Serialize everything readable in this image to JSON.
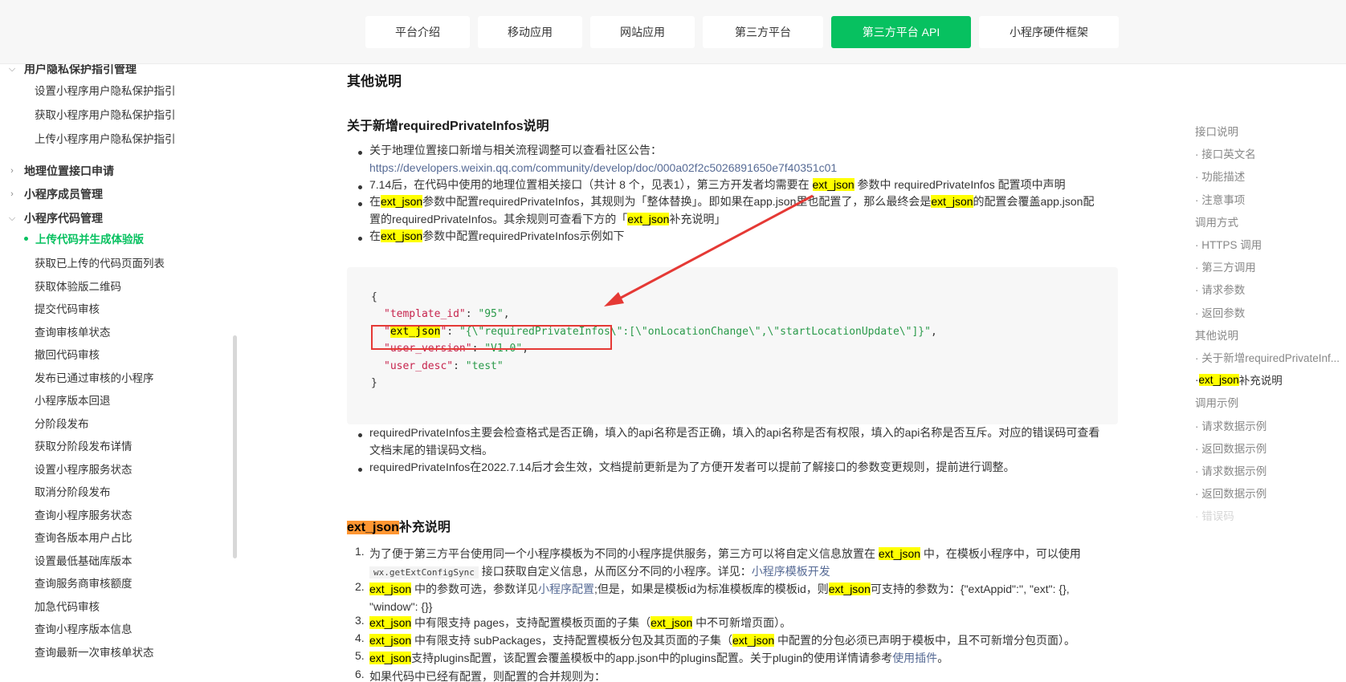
{
  "topnav": [
    {
      "label": "平台介绍",
      "active": false
    },
    {
      "label": "移动应用",
      "active": false
    },
    {
      "label": "网站应用",
      "active": false
    },
    {
      "label": "第三方平台",
      "active": false
    },
    {
      "label": "第三方平台 API",
      "active": true
    },
    {
      "label": "小程序硬件框架",
      "active": false
    }
  ],
  "sidebar": {
    "group_privacy": "用户隐私保护指引管理",
    "privacy_items": [
      "设置小程序用户隐私保护指引",
      "获取小程序用户隐私保护指引",
      "上传小程序用户隐私保护指引"
    ],
    "group_location": "地理位置接口申请",
    "group_members": "小程序成员管理",
    "group_code": "小程序代码管理",
    "active_item": "上传代码并生成体验版",
    "code_items": [
      "获取已上传的代码页面列表",
      "获取体验版二维码",
      "提交代码审核",
      "查询审核单状态",
      "撤回代码审核",
      "发布已通过审核的小程序",
      "小程序版本回退",
      "分阶段发布",
      "获取分阶段发布详情",
      "设置小程序服务状态",
      "取消分阶段发布",
      "查询小程序服务状态",
      "查询各版本用户占比",
      "设置最低基础库版本",
      "查询服务商审核额度",
      "加急代码审核",
      "查询小程序版本信息",
      "查询最新一次审核单状态"
    ]
  },
  "main": {
    "title": "其他说明",
    "section1_title": "关于新增requiredPrivateInfos说明",
    "b1_text": "关于地理位置接口新增与相关流程调整可以查看社区公告：",
    "b1_link": "https://developers.weixin.qq.com/community/develop/doc/000a02f2c5026891650e7f40351c01",
    "b2_a": "7.14后，在代码中使用的地理位置相关接口（共计 8 个，见表1），第三方开发者均需要在 ",
    "ext_json": "ext_json",
    "b2_b": " 参数中 requiredPrivateInfos 配置项中声明",
    "b3_a": "在",
    "b3_b": "参数中配置requiredPrivateInfos，其规则为「整体替换」。即如果在app.json里也配置了，那么最终会是",
    "b3_c": "的配置会覆盖app.json配",
    "b3_d": "置的requiredPrivateInfos。其余规则可查看下方的「",
    "b3_e": "补充说明」",
    "b4_a": "在",
    "b4_b": "参数中配置requiredPrivateInfos示例如下",
    "code": {
      "open": "{",
      "k1": "\"template_id\"",
      "v1": "\"95\"",
      "k2_pre": "\"",
      "k2_hl": "ext_json",
      "k2_post": "\"",
      "v2": "\"{\\\"requiredPrivateInfos\\\":[\\\"onLocationChange\\\",\\\"startLocationUpdate\\\"]}\"",
      "k3": "\"user_version\"",
      "v3": "\"V1.0\"",
      "k4": "\"user_desc\"",
      "v4": "\"test\"",
      "close": "}"
    },
    "b5_a": "requiredPrivateInfos主要会检查格式是否正确，填入的api名称是否正确，填入的api名称是否有权限，填入的api名称是否互斥。对应的错误码可查看",
    "b5_b": "文档末尾的错误码文档。",
    "b6": "requiredPrivateInfos在2022.7.14后才会生效，文档提前更新是为了方便开发者可以提前了解接口的参数变更规则，提前进行调整。",
    "section2_hl": "ext_json",
    "section2_rest": "补充说明",
    "n1_a": "为了便于第三方平台使用同一个小程序模板为不同的小程序提供服务，第三方可以将自定义信息放置在 ",
    "n1_b": " 中，在模板小程序中，可以使用",
    "n1_code": "wx.getExtConfigSync",
    "n1_c": " 接口获取自定义信息，从而区分不同的小程序。详见：",
    "n1_link": "小程序模板开发",
    "n2_a": " 中的参数可选，参数详见",
    "n2_link": "小程序配置",
    "n2_b": ";但是，如果是模板id为标准模板库的模板id，则",
    "n2_c": "可支持的参数为：{\"extAppid\":'', \"ext\": {},",
    "n2_d": "\"window\": {}}",
    "n3_a": " 中有限支持 pages，支持配置模板页面的子集（",
    "n3_b": " 中不可新增页面）。",
    "n4_a": " 中有限支持 subPackages，支持配置模板分包及其页面的子集（",
    "n4_b": " 中配置的分包必须已声明于模板中，且不可新增分包页面）。",
    "n5_a": "支持plugins配置，该配置会覆盖模板中的app.json中的plugins配置。关于plugin的使用详情请参考",
    "n5_link": "使用插件",
    "n5_b": "。",
    "n6": "如果代码中已经有配置，则配置的合并规则为："
  },
  "toc": [
    {
      "label": "接口说明",
      "sub": false
    },
    {
      "label": "· 接口英文名",
      "sub": true
    },
    {
      "label": "· 功能描述",
      "sub": true
    },
    {
      "label": "· 注意事项",
      "sub": true
    },
    {
      "label": "调用方式",
      "sub": false
    },
    {
      "label": "· HTTPS 调用",
      "sub": true
    },
    {
      "label": "· 第三方调用",
      "sub": true
    },
    {
      "label": "· 请求参数",
      "sub": true
    },
    {
      "label": "· 返回参数",
      "sub": true
    },
    {
      "label": "其他说明",
      "sub": false
    },
    {
      "label": "· 关于新增requiredPrivateInf...",
      "sub": true
    },
    {
      "label": "ext_json",
      "rest": "补充说明",
      "sub": true,
      "current": true
    },
    {
      "label": "调用示例",
      "sub": false
    },
    {
      "label": "· 请求数据示例",
      "sub": true
    },
    {
      "label": "· 返回数据示例",
      "sub": true
    },
    {
      "label": "· 请求数据示例",
      "sub": true
    },
    {
      "label": "· 返回数据示例",
      "sub": true
    },
    {
      "label": "· 错误码",
      "sub": true
    }
  ]
}
